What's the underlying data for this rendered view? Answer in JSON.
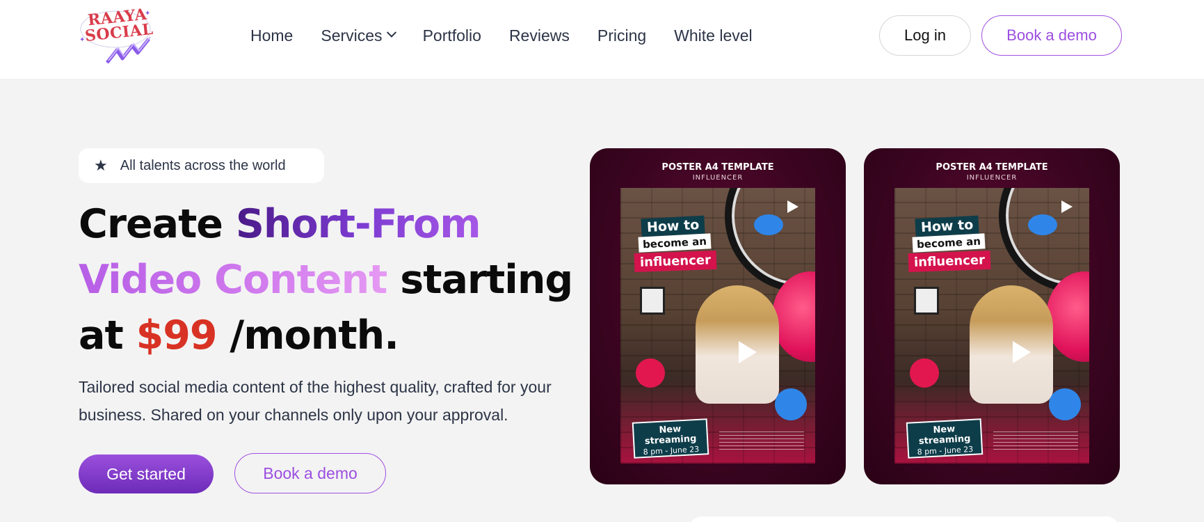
{
  "header": {
    "logo": {
      "line1": "RAAYA",
      "line2": "SOCIAL"
    },
    "nav": [
      {
        "label": "Home"
      },
      {
        "label": "Services",
        "has_dropdown": true
      },
      {
        "label": "Portfolio"
      },
      {
        "label": "Reviews"
      },
      {
        "label": "Pricing"
      },
      {
        "label": "White level"
      }
    ],
    "login_label": "Log in",
    "book_demo_label": "Book a demo"
  },
  "hero": {
    "badge": {
      "icon": "star-icon",
      "text": "All talents across the world"
    },
    "headline": {
      "w1": "Create",
      "w2": "Short-From",
      "w3": "Video Content",
      "w4": "starting",
      "w5": "at",
      "w6": "$99",
      "w7": "/month."
    },
    "subtext": "Tailored social media content of the highest quality, crafted for your business. Shared on your channels only upon your approval.",
    "get_started_label": "Get started",
    "book_demo_label": "Book a demo"
  },
  "videos": [
    {
      "poster_title": "POSTER A4 TEMPLATE",
      "poster_subtitle": "INFLUENCER",
      "headline_1": "How to",
      "headline_2": "become an",
      "headline_3": "influencer",
      "tag_1": "New",
      "tag_2": "streaming",
      "tag_3": "8 pm - June 23"
    },
    {
      "poster_title": "POSTER A4 TEMPLATE",
      "poster_subtitle": "INFLUENCER",
      "headline_1": "How to",
      "headline_2": "become an",
      "headline_3": "influencer",
      "tag_1": "New",
      "tag_2": "streaming",
      "tag_3": "8 pm - June 23"
    }
  ],
  "colors": {
    "brand_purple": "#9b4ee0",
    "price_red": "#d83224",
    "text_dark": "#2c3446",
    "background": "#f3f3f3"
  }
}
